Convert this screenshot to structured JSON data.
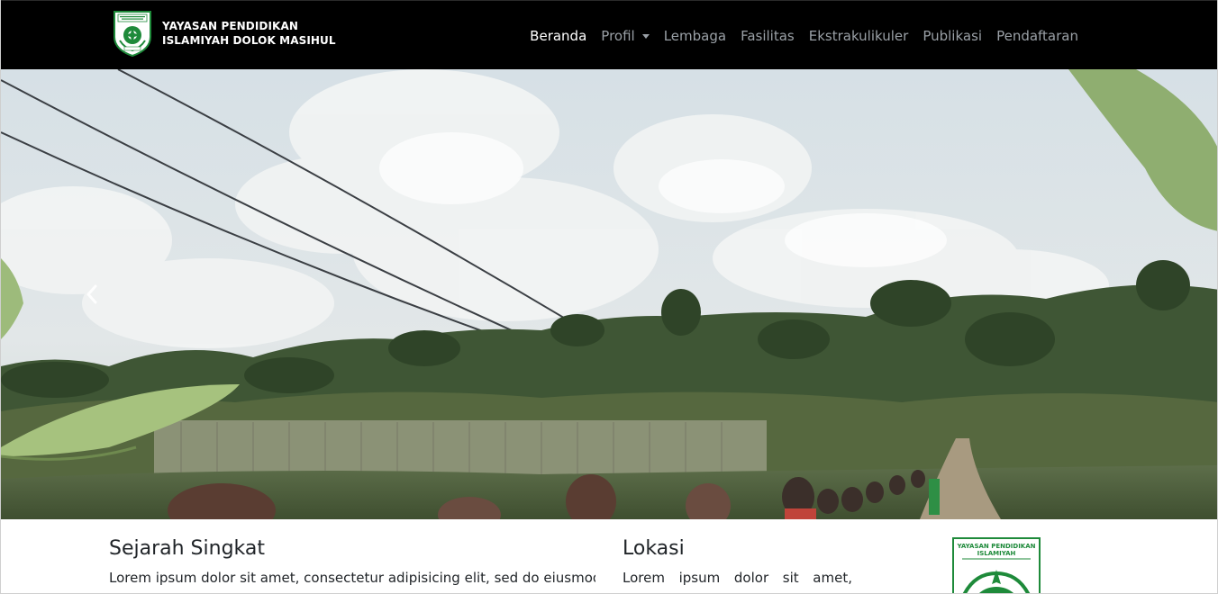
{
  "brand": {
    "line1": "YAYASAN PENDIDIKAN",
    "line2": "ISLAMIYAH DOLOK MASIHUL",
    "logo_icon": "foundation-emblem-icon",
    "logo_small_text": "YAYASAN PENDIDIKAN ISLAMIYAH"
  },
  "nav": {
    "items": [
      {
        "label": "Beranda",
        "active": true
      },
      {
        "label": "Profil",
        "dropdown": true
      },
      {
        "label": "Lembaga"
      },
      {
        "label": "Fasilitas"
      },
      {
        "label": "Ekstrakulikuler"
      },
      {
        "label": "Publikasi"
      },
      {
        "label": "Pendaftaran"
      }
    ]
  },
  "hero": {
    "image": "carousel-photo-students-walking-palm-plantation",
    "prev_icon": "chevron-left-icon"
  },
  "sections": {
    "history": {
      "title": "Sejarah Singkat",
      "text": "Lorem ipsum dolor sit amet, consectetur adipisicing elit, sed do eiusmod"
    },
    "location": {
      "title": "Lokasi",
      "text": "Lorem ipsum dolor sit amet,"
    },
    "side_logo": {
      "text": "YAYASAN PENDIDIKAN ISLAMIYAH"
    }
  },
  "colors": {
    "navbar_bg": "#000000",
    "nav_text": "#9aa0a6",
    "nav_active": "#ffffff",
    "brand_green": "#1e8a3a"
  }
}
